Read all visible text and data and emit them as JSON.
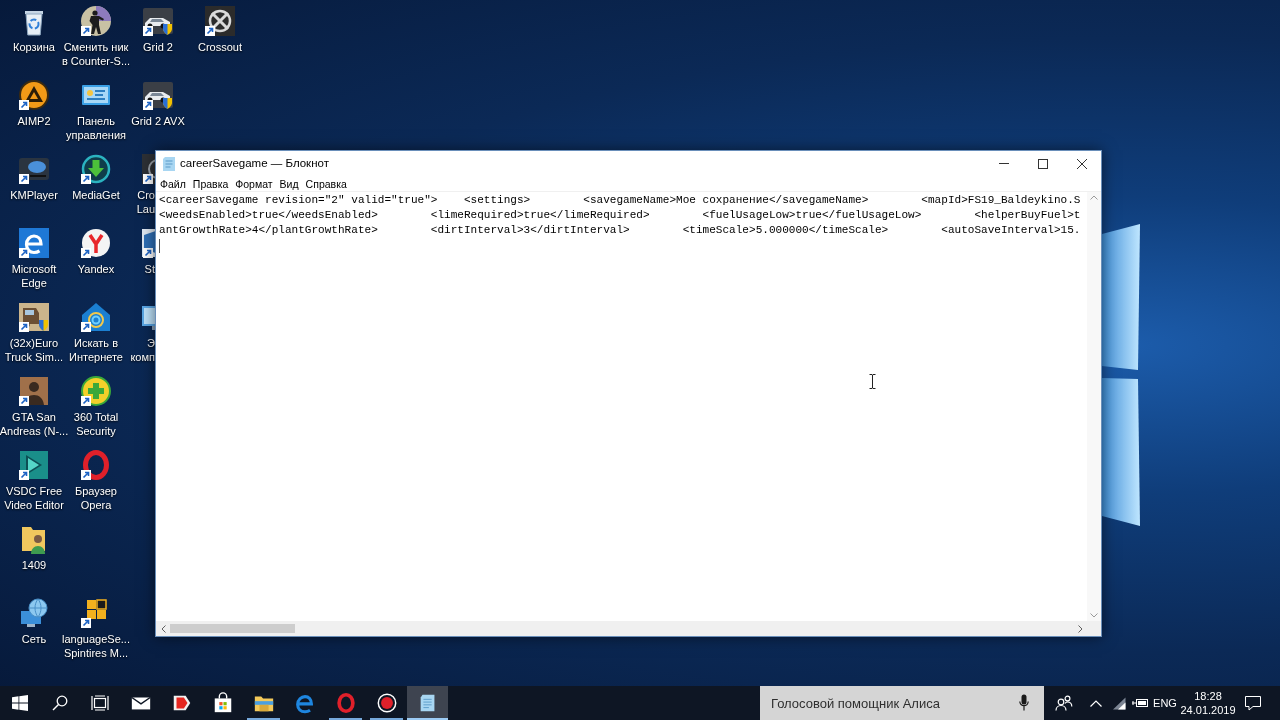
{
  "desktop": {
    "columns": [
      [
        {
          "label": "Корзина",
          "kind": "recycle-bin",
          "shortcut": false,
          "covered": false
        },
        {
          "label": "AIMP2",
          "kind": "aimp",
          "shortcut": true,
          "covered": false
        },
        {
          "label": "KMPlayer",
          "kind": "media-player",
          "shortcut": true,
          "covered": false
        },
        {
          "label": "Microsoft Edge",
          "kind": "edge",
          "shortcut": true,
          "covered": false
        },
        {
          "label": "(32x)Euro Truck Sim...",
          "kind": "truck",
          "shortcut": true,
          "covered": false
        },
        {
          "label": "GTA San Andreas (N-...",
          "kind": "portrait",
          "shortcut": true,
          "covered": false
        },
        {
          "label": "VSDC Free Video Editor",
          "kind": "video-editor",
          "shortcut": true,
          "covered": false
        },
        {
          "label": "1409",
          "kind": "user-folder",
          "shortcut": false,
          "covered": false
        },
        {
          "label": "Сеть",
          "kind": "network",
          "shortcut": false,
          "covered": false
        }
      ],
      [
        {
          "label": "Сменить ник в Counter-S...",
          "kind": "soldier",
          "shortcut": true,
          "covered": false
        },
        {
          "label": "Панель управления",
          "kind": "control-panel",
          "shortcut": false,
          "covered": false
        },
        {
          "label": "MediaGet",
          "kind": "download",
          "shortcut": true,
          "covered": false
        },
        {
          "label": "Yandex",
          "kind": "yandex",
          "shortcut": true,
          "covered": false
        },
        {
          "label": "Искать в Интернете",
          "kind": "web-search",
          "shortcut": true,
          "covered": false
        },
        {
          "label": "360 Total Security",
          "kind": "antivirus",
          "shortcut": true,
          "covered": false
        },
        {
          "label": "Браузер Opera",
          "kind": "opera",
          "shortcut": true,
          "covered": false
        },
        null,
        {
          "label": "languageSe... Spintires M...",
          "kind": "squares",
          "shortcut": true,
          "covered": false
        }
      ],
      [
        {
          "label": "Grid 2",
          "kind": "car",
          "shortcut": true,
          "covered": false
        },
        {
          "label": "Grid 2 AVX",
          "kind": "car",
          "shortcut": true,
          "covered": false
        },
        {
          "label": "Cro Lau",
          "kind": "dark-tile",
          "shortcut": true,
          "covered": true
        },
        {
          "label": "St",
          "kind": "light-tile",
          "shortcut": true,
          "covered": true
        },
        {
          "label": "Э комп",
          "kind": "monitor",
          "shortcut": false,
          "covered": true
        }
      ],
      [
        {
          "label": "Crossout",
          "kind": "crossout",
          "shortcut": true,
          "covered": false
        }
      ]
    ]
  },
  "notepad": {
    "title": "careerSavegame — Блокнот",
    "menu": [
      "Файл",
      "Правка",
      "Формат",
      "Вид",
      "Справка"
    ],
    "lines": [
      "<careerSavegame revision=\"2\" valid=\"true\">    <settings>        <savegameName>Мое сохранение</savegameName>        <mapId>FS19_Baldeykino.S",
      "<weedsEnabled>true</weedsEnabled>        <limeRequired>true</limeRequired>        <fuelUsageLow>true</fuelUsageLow>        <helperBuyFuel>t",
      "antGrowthRate>4</plantGrowthRate>        <dirtInterval>3</dirtInterval>        <timeScale>5.000000</timeScale>        <autoSaveInterval>15."
    ]
  },
  "taskbar": {
    "apps": [
      {
        "kind": "mail",
        "running": false,
        "selected": false
      },
      {
        "kind": "yandex",
        "running": false,
        "selected": false
      },
      {
        "kind": "store",
        "running": false,
        "selected": false
      },
      {
        "kind": "explorer",
        "running": true,
        "selected": false
      },
      {
        "kind": "edge",
        "running": false,
        "selected": false
      },
      {
        "kind": "opera",
        "running": true,
        "selected": false
      },
      {
        "kind": "recorder",
        "running": true,
        "selected": false
      },
      {
        "kind": "notepad",
        "running": true,
        "selected": true
      }
    ],
    "assistant": {
      "placeholder": "Голосовой помощник Алиса"
    },
    "language": "ENG",
    "time": "18:28",
    "date": "24.01.2019"
  }
}
